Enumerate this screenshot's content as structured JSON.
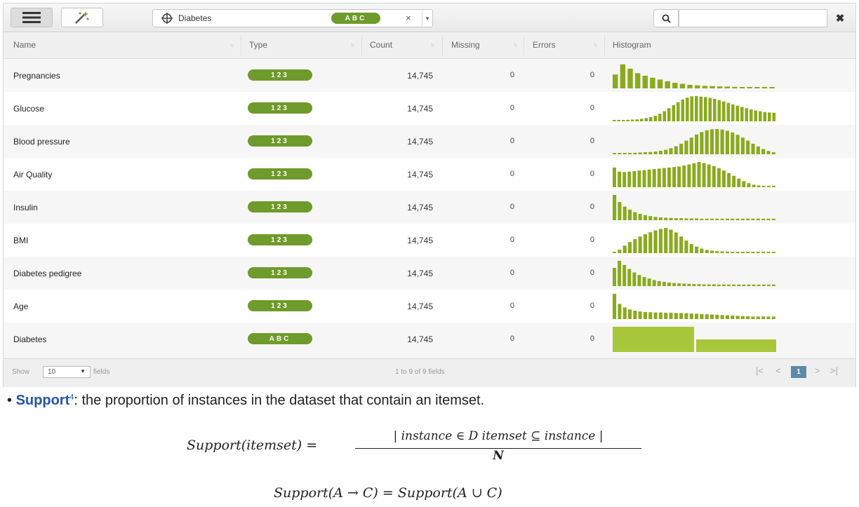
{
  "toolbar": {
    "menu_icon": "hamburger-icon",
    "tool_icon": "wand-icon",
    "dataset_icon": "crosshair-icon",
    "dataset_name": "Diabetes",
    "dataset_type": "ABC",
    "clear_label": "×",
    "search_icon": "search-icon",
    "search_value": "",
    "search_close": "✖"
  },
  "table": {
    "columns": [
      "Name",
      "Type",
      "Count",
      "Missing",
      "Errors",
      "Histogram"
    ],
    "accent_color": "#6f9a2c",
    "hist_color": "#8aaa1e",
    "rows": [
      {
        "name": "Pregnancies",
        "type": "123",
        "count": "14,745",
        "missing": "0",
        "errors": "0",
        "hist": [
          0.55,
          0.95,
          0.78,
          0.6,
          0.5,
          0.42,
          0.35,
          0.28,
          0.22,
          0.18,
          0.14,
          0.12,
          0.1,
          0.09,
          0.08,
          0.07,
          0.06,
          0.05,
          0.05,
          0.04,
          0.04,
          0.04
        ]
      },
      {
        "name": "Glucose",
        "type": "123",
        "count": "14,745",
        "missing": "0",
        "errors": "0",
        "hist": [
          0.04,
          0.04,
          0.05,
          0.06,
          0.07,
          0.08,
          0.1,
          0.13,
          0.17,
          0.22,
          0.3,
          0.4,
          0.52,
          0.64,
          0.76,
          0.86,
          0.94,
          0.99,
          1.0,
          0.98,
          0.96,
          0.93,
          0.89,
          0.84,
          0.79,
          0.73,
          0.67,
          0.62,
          0.57,
          0.52,
          0.47,
          0.43,
          0.4,
          0.37,
          0.35,
          0.34
        ]
      },
      {
        "name": "Blood pressure",
        "type": "123",
        "count": "14,745",
        "missing": "0",
        "errors": "0",
        "hist": [
          0.04,
          0.04,
          0.05,
          0.05,
          0.06,
          0.07,
          0.08,
          0.09,
          0.11,
          0.14,
          0.18,
          0.24,
          0.32,
          0.42,
          0.54,
          0.66,
          0.78,
          0.88,
          0.95,
          0.99,
          1.0,
          0.98,
          0.93,
          0.86,
          0.77,
          0.66,
          0.54,
          0.42,
          0.31,
          0.21,
          0.13,
          0.08
        ]
      },
      {
        "name": "Air Quality",
        "type": "123",
        "count": "14,745",
        "missing": "0",
        "errors": "0",
        "hist": [
          0.78,
          0.62,
          0.6,
          0.62,
          0.64,
          0.66,
          0.68,
          0.7,
          0.72,
          0.74,
          0.76,
          0.78,
          0.8,
          0.82,
          0.86,
          0.9,
          0.95,
          1.0,
          0.96,
          0.9,
          0.84,
          0.76,
          0.66,
          0.56,
          0.45,
          0.34,
          0.24,
          0.16,
          0.1,
          0.07,
          0.06,
          0.05,
          0.05
        ]
      },
      {
        "name": "Insulin",
        "type": "123",
        "count": "14,745",
        "missing": "0",
        "errors": "0",
        "hist": [
          1.0,
          0.72,
          0.54,
          0.42,
          0.32,
          0.25,
          0.2,
          0.16,
          0.13,
          0.11,
          0.1,
          0.09,
          0.08,
          0.08,
          0.07,
          0.07,
          0.07,
          0.06,
          0.06,
          0.06,
          0.06,
          0.06,
          0.06,
          0.06,
          0.06,
          0.06,
          0.06,
          0.06,
          0.06,
          0.06,
          0.06,
          0.06
        ]
      },
      {
        "name": "BMI",
        "type": "123",
        "count": "14,745",
        "missing": "0",
        "errors": "0",
        "hist": [
          0.05,
          0.14,
          0.3,
          0.44,
          0.56,
          0.66,
          0.75,
          0.83,
          0.9,
          0.96,
          1.0,
          0.93,
          0.82,
          0.66,
          0.5,
          0.36,
          0.26,
          0.18,
          0.13,
          0.1,
          0.08,
          0.07,
          0.06,
          0.05,
          0.05,
          0.05,
          0.05,
          0.05,
          0.05,
          0.05,
          0.05,
          0.05
        ]
      },
      {
        "name": "Diabetes pedigree",
        "type": "123",
        "count": "14,745",
        "missing": "0",
        "errors": "0",
        "hist": [
          0.72,
          1.0,
          0.84,
          0.68,
          0.54,
          0.44,
          0.36,
          0.3,
          0.24,
          0.2,
          0.17,
          0.14,
          0.12,
          0.11,
          0.1,
          0.09,
          0.08,
          0.08,
          0.07,
          0.07,
          0.07,
          0.06,
          0.06,
          0.06,
          0.06,
          0.06,
          0.06,
          0.06,
          0.06,
          0.06,
          0.06,
          0.06,
          0.06
        ]
      },
      {
        "name": "Age",
        "type": "123",
        "count": "14,745",
        "missing": "0",
        "errors": "0",
        "hist": [
          1.0,
          0.6,
          0.46,
          0.38,
          0.33,
          0.3,
          0.28,
          0.27,
          0.26,
          0.26,
          0.25,
          0.25,
          0.24,
          0.24,
          0.23,
          0.22,
          0.21,
          0.2,
          0.19,
          0.18,
          0.17,
          0.16,
          0.15,
          0.14,
          0.13,
          0.12,
          0.11,
          0.1,
          0.1,
          0.1,
          0.1,
          0.1
        ]
      },
      {
        "name": "Diabetes",
        "type": "ABC",
        "count": "14,745",
        "missing": "0",
        "errors": "0",
        "hist_categorical": [
          1.0,
          0.5
        ]
      }
    ]
  },
  "footer": {
    "show_label": "Show",
    "page_size": "10",
    "fields_label": "fields",
    "range_label": "1 to 9 of 9 fields",
    "first_icon": "first-page-icon",
    "prev_icon": "prev-page-icon",
    "current_page": "1",
    "next_icon": "next-page-icon",
    "last_icon": "last-page-icon"
  },
  "text": {
    "bullet": "•",
    "term": "Support",
    "footnote": "4",
    "definition": ": the proportion of instances in the dataset that contain an itemset.",
    "formula1_lhs": "Support(itemset) =",
    "formula1_num": "| instance ∈ D itemset ⊆ instance |",
    "formula1_den": "N",
    "formula2": "Support(A → C) = Support(A ∪ C)"
  }
}
